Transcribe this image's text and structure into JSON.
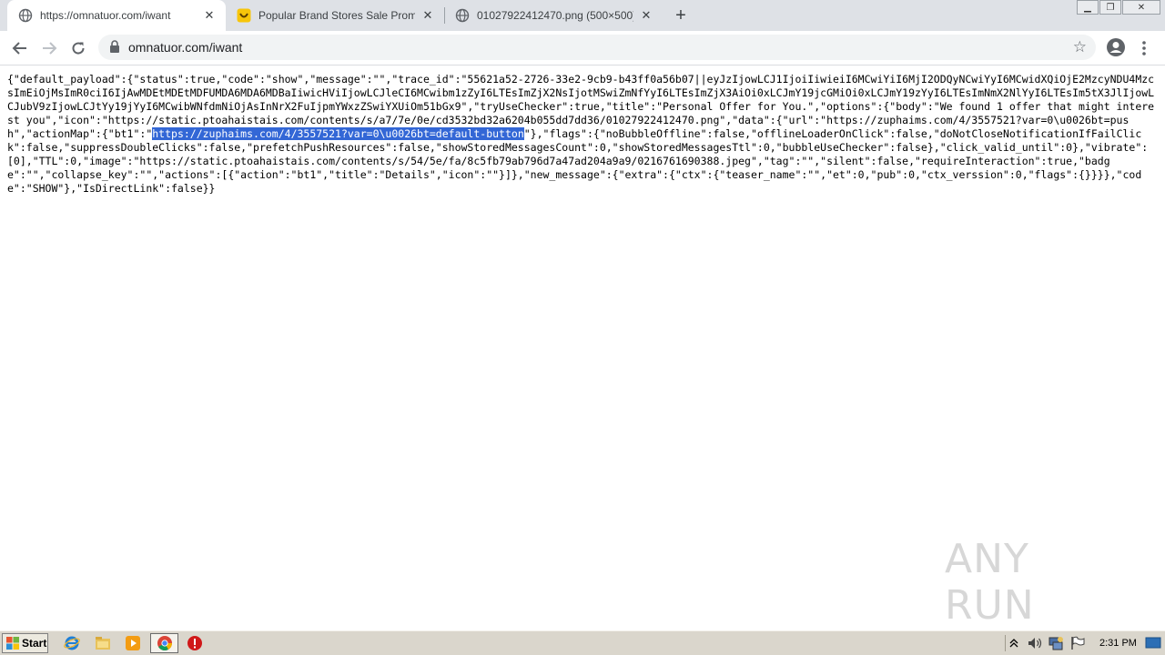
{
  "tabs": [
    {
      "title": "https://omnatuor.com/iwant",
      "favicon": "globe-icon"
    },
    {
      "title": "Popular Brand Stores Sale Promotion",
      "favicon": "smiley-icon"
    },
    {
      "title": "01027922412470.png (500×500)",
      "favicon": "globe-icon"
    }
  ],
  "toolbar": {
    "url": "omnatuor.com/iwant"
  },
  "content": {
    "before": "{\"default_payload\":{\"status\":true,\"code\":\"show\",\"message\":\"\",\"trace_id\":\"55621a52-2726-33e2-9cb9-b43ff0a56b07||eyJzIjowLCJ1IjoiIiwieiI6MCwiYiI6MjI2ODQyNCwiYyI6MCwidXQiOjE2MzcyNDU4MzcsImEiOjMsImR0ciI6IjAwMDEtMDEtMDFUMDA6MDA6MDBaIiwicHViIjowLCJleCI6MCwibm1zZyI6LTEsImZjX2NsIjotMSwiZmNfYyI6LTEsImZjX3AiOi0xLCJmY19jcGMiOi0xLCJmY19zYyI6LTEsImNmX2NlYyI6LTEsIm5tX3JlIjowLCJubV9zIjowLCJtYy19jYyI6MCwibWNfdmNiOjAsInNrX2FuIjpmYWxzZSwiYXUiOm51bGx9\",\"tryUseChecker\":true,\"title\":\"Personal Offer for You.\",\"options\":{\"body\":\"We found 1 offer that might interest you\",\"icon\":\"https://static.ptoahaistais.com/contents/s/a7/7e/0e/cd3532bd32a6204b055dd7dd36/01027922412470.png\",\"data\":{\"url\":\"https://zuphaims.com/4/3557521?var=0\\u0026bt=push\",\"actionMap\":{\"bt1\":\"",
    "selected": "https://zuphaims.com/4/3557521?var=0\\u0026bt=default-button",
    "after": "\"},\"flags\":{\"noBubbleOffline\":false,\"offlineLoaderOnClick\":false,\"doNotCloseNotificationIfFailClick\":false,\"suppressDoubleClicks\":false,\"prefetchPushResources\":false,\"showStoredMessagesCount\":0,\"showStoredMessagesTtl\":0,\"bubbleUseChecker\":false},\"click_valid_until\":0},\"vibrate\":[0],\"TTL\":0,\"image\":\"https://static.ptoahaistais.com/contents/s/54/5e/fa/8c5fb79ab796d7a47ad204a9a9/0216761690388.jpeg\",\"tag\":\"\",\"silent\":false,\"requireInteraction\":true,\"badge\":\"\",\"collapse_key\":\"\",\"actions\":[{\"action\":\"bt1\",\"title\":\"Details\",\"icon\":\"\"}]},\"new_message\":{\"extra\":{\"ctx\":{\"teaser_name\":\"\",\"et\":0,\"pub\":0,\"ctx_verssion\":0,\"flags\":{}}}},\"code\":\"SHOW\"},\"IsDirectLink\":false}}"
  },
  "watermark": "ANY RUN",
  "taskbar": {
    "start_label": "Start",
    "clock": "2:31 PM"
  },
  "colors": {
    "tabstrip": "#dee1e6",
    "selection": "#3367d6",
    "taskbar": "#dad6cc"
  }
}
